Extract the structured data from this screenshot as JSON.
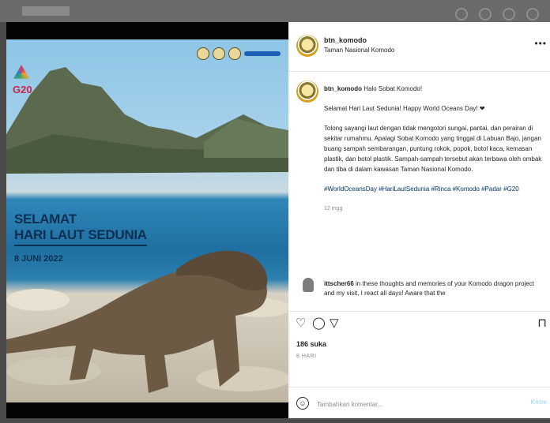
{
  "post": {
    "username": "btn_komodo",
    "location": "Taman Nasional Komodo",
    "image": {
      "logo_text": "G20",
      "headline_line1": "SELAMAT",
      "headline_line2": "HARI LAUT SEDUNIA",
      "headline_date": "8 JUNI 2022"
    },
    "caption": {
      "username": "btn_komodo",
      "greeting": "Halo Sobat Komodo!",
      "line1": "Selamat Hari Laut Sedunia! Happy World Oceans Day! ❤",
      "body": "Tolong sayangi laut dengan tidak mengotori sungai, pantai, dan perairan di sekitar rumahmu. Apalagi Sobat Komodo yang tinggal di Labuan Bajo, jangan buang sampah sembarangan, puntung rokok, popok, botol kaca, kemasan plastik, dan botol plastik. Sampah-sampah tersebut akan terbawa oleh ombak dan tiba di dalam kawasan Taman Nasional Komodo.",
      "hashtags": "#WorldOceansDay #HariLautSedunia #Rinca #Komodo #Padar #G20",
      "time_ago": "12 mgg"
    },
    "comment": {
      "username": "ittscher66",
      "text": "in these thoughts and memories of your Komodo dragon project and my visit, I react all days! Aware that the"
    },
    "likes": "186 suka",
    "timestamp": "8 HARI",
    "add_comment_placeholder": "Tambahkan komentar...",
    "post_label": "Kirim"
  },
  "icons": {
    "like": "heart-outline-icon",
    "comment": "comment-bubble-icon",
    "share": "paper-plane-icon",
    "save": "bookmark-icon",
    "emoji": "smiley-icon",
    "more": "more-dots-icon"
  },
  "colors": {
    "headline": "#0d2f52",
    "link": "#00376b",
    "g20": "#c9234f"
  }
}
